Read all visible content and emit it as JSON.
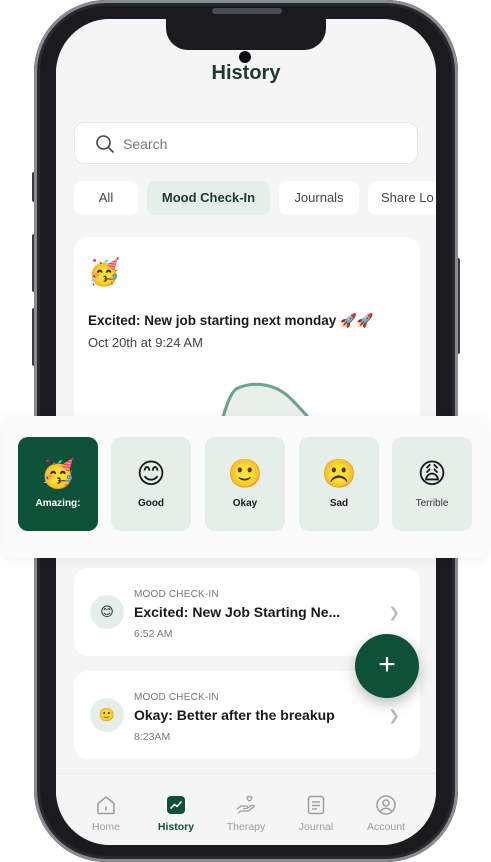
{
  "header": {
    "title": "History"
  },
  "search": {
    "placeholder": "Search"
  },
  "filters": [
    "All",
    "Mood Check-In",
    "Journals",
    "Share Lo"
  ],
  "featured": {
    "emoji": "🥳",
    "title": "Excited: New job starting next monday 🚀🚀",
    "time": "Oct 20th at 9:24 AM"
  },
  "moods": [
    {
      "emoji": "🥳",
      "label": "Amazing:"
    },
    {
      "emoji": "😊",
      "label": "Good"
    },
    {
      "emoji": "🙂",
      "label": "Okay"
    },
    {
      "emoji": "☹️",
      "label": "Sad"
    },
    {
      "emoji": "😩",
      "label": "Terrible"
    }
  ],
  "entries": [
    {
      "emoji": "😊",
      "kind": "MOOD CHECK-IN",
      "title": "Excited: New Job Starting Ne...",
      "time": "6:52 AM"
    },
    {
      "emoji": "🙂",
      "kind": "MOOD CHECK-IN",
      "title": "Okay: Better after the breakup",
      "time": "8:23AM"
    }
  ],
  "fab": {
    "label": "+"
  },
  "tabs": [
    {
      "label": "Home",
      "icon": "home-icon"
    },
    {
      "label": "History",
      "icon": "history-chart-icon"
    },
    {
      "label": "Therapy",
      "icon": "therapy-hand-heart-icon"
    },
    {
      "label": "Journal",
      "icon": "journal-icon"
    },
    {
      "label": "Account",
      "icon": "account-icon"
    }
  ],
  "colors": {
    "brand": "#0d5236",
    "accent_soft": "#e6eee9",
    "chart_line": "#6aa489",
    "chart_fill": "#e9efe9"
  }
}
